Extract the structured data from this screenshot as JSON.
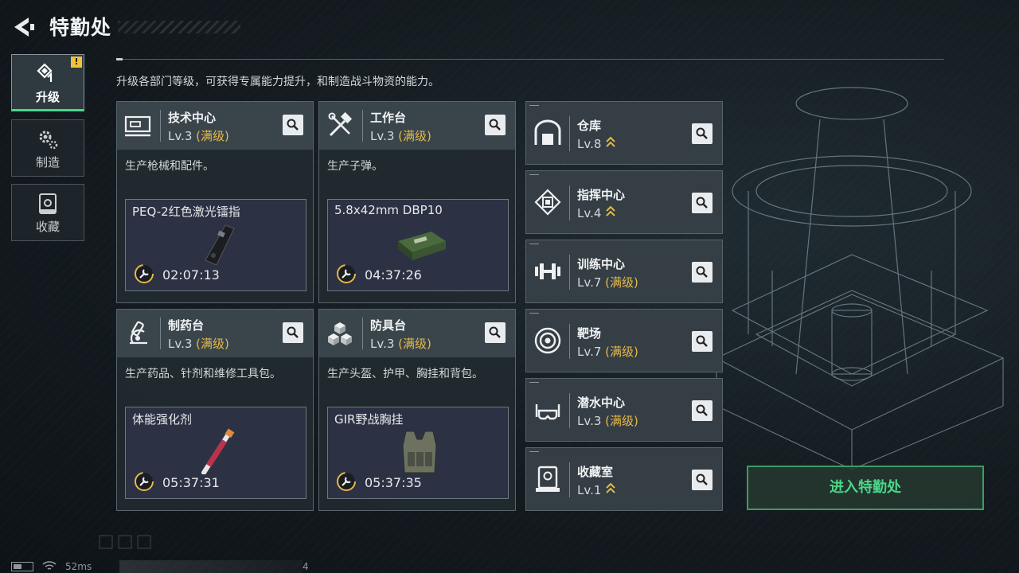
{
  "header": {
    "title": "特勤处"
  },
  "sidebar": {
    "tabs": [
      {
        "label": "升级",
        "active": true,
        "icon": "upgrade-icon",
        "alert": "!"
      },
      {
        "label": "制造",
        "active": false,
        "icon": "gear-icon"
      },
      {
        "label": "收藏",
        "active": false,
        "icon": "collection-icon"
      }
    ]
  },
  "description": "升级各部门等级，可获得专属能力提升，和制造战斗物资的能力。",
  "production_cards": [
    {
      "name": "技术中心",
      "level": "Lv.3",
      "max_tag": "(满级)",
      "icon": "monitor-icon",
      "desc": "生产枪械和配件。",
      "product": "PEQ-2红色激光镭指",
      "timer": "02:07:13"
    },
    {
      "name": "工作台",
      "level": "Lv.3",
      "max_tag": "(满级)",
      "icon": "tools-icon",
      "desc": "生产子弹。",
      "product": "5.8x42mm DBP10",
      "timer": "04:37:26"
    },
    {
      "name": "制药台",
      "level": "Lv.3",
      "max_tag": "(满级)",
      "icon": "microscope-icon",
      "desc": "生产药品、针剂和维修工具包。",
      "product": "体能强化剂",
      "timer": "05:37:31"
    },
    {
      "name": "防具台",
      "level": "Lv.3",
      "max_tag": "(满级)",
      "icon": "cubes-icon",
      "desc": "生产头盔、护甲、胸挂和背包。",
      "product": "GIR野战胸挂",
      "timer": "05:37:35"
    }
  ],
  "facilities": [
    {
      "name": "仓库",
      "level": "Lv.8",
      "max_tag": "",
      "upgradable": true,
      "icon": "warehouse-icon"
    },
    {
      "name": "指挥中心",
      "level": "Lv.4",
      "max_tag": "",
      "upgradable": true,
      "icon": "chip-icon"
    },
    {
      "name": "训练中心",
      "level": "Lv.7",
      "max_tag": "(满级)",
      "upgradable": false,
      "icon": "dumbbell-icon"
    },
    {
      "name": "靶场",
      "level": "Lv.7",
      "max_tag": "(满级)",
      "upgradable": false,
      "icon": "target-icon"
    },
    {
      "name": "潜水中心",
      "level": "Lv.3",
      "max_tag": "(满级)",
      "upgradable": false,
      "icon": "diving-mask-icon"
    },
    {
      "name": "收藏室",
      "level": "Lv.1",
      "max_tag": "",
      "upgradable": true,
      "icon": "collection-room-icon"
    }
  ],
  "enter_button": "进入特勤处",
  "status": {
    "ping": "52ms",
    "bottom_number": "4"
  },
  "colors": {
    "accent_green": "#4bd68a",
    "max_gold": "#e6b94a",
    "alert_yellow": "#f0c23a"
  }
}
